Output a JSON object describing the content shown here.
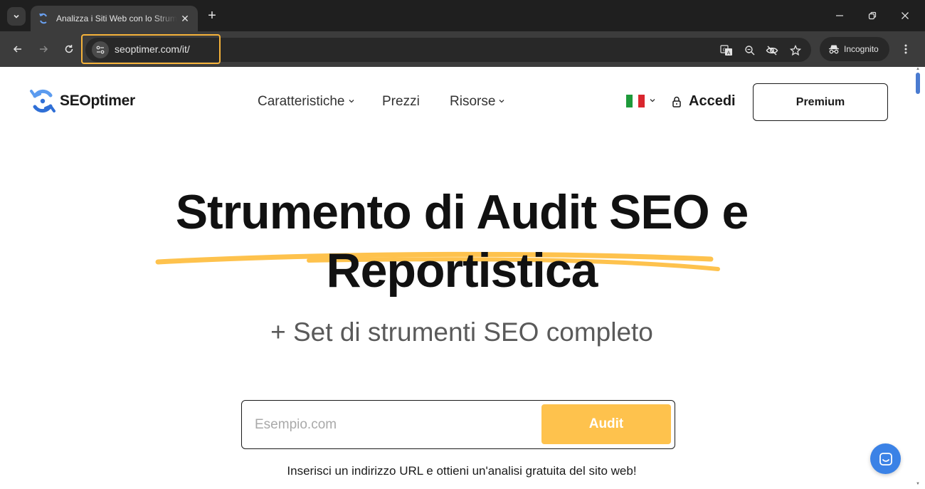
{
  "browser": {
    "tab": {
      "title": "Analizza i Siti Web con lo Strumento SEO"
    },
    "url": "seoptimer.com/it/",
    "incognito_label": "Incognito"
  },
  "site": {
    "logo_text": "SEOptimer",
    "nav": {
      "features": "Caratteristiche",
      "pricing": "Prezzi",
      "resources": "Risorse"
    },
    "login": "Accedi",
    "premium": "Premium"
  },
  "hero": {
    "title_line1": "Strumento di Audit SEO e",
    "title_line2": "Reportistica",
    "subtitle": "+ Set di strumenti SEO completo"
  },
  "audit": {
    "placeholder": "Esempio.com",
    "button": "Audit",
    "hint": "Inserisci un indirizzo URL e ottieni un'analisi gratuita del sito web!"
  },
  "colors": {
    "accent_yellow": "#fec24d",
    "brand_blue": "#3b82e6",
    "highlight_orange": "#f5b23a"
  }
}
